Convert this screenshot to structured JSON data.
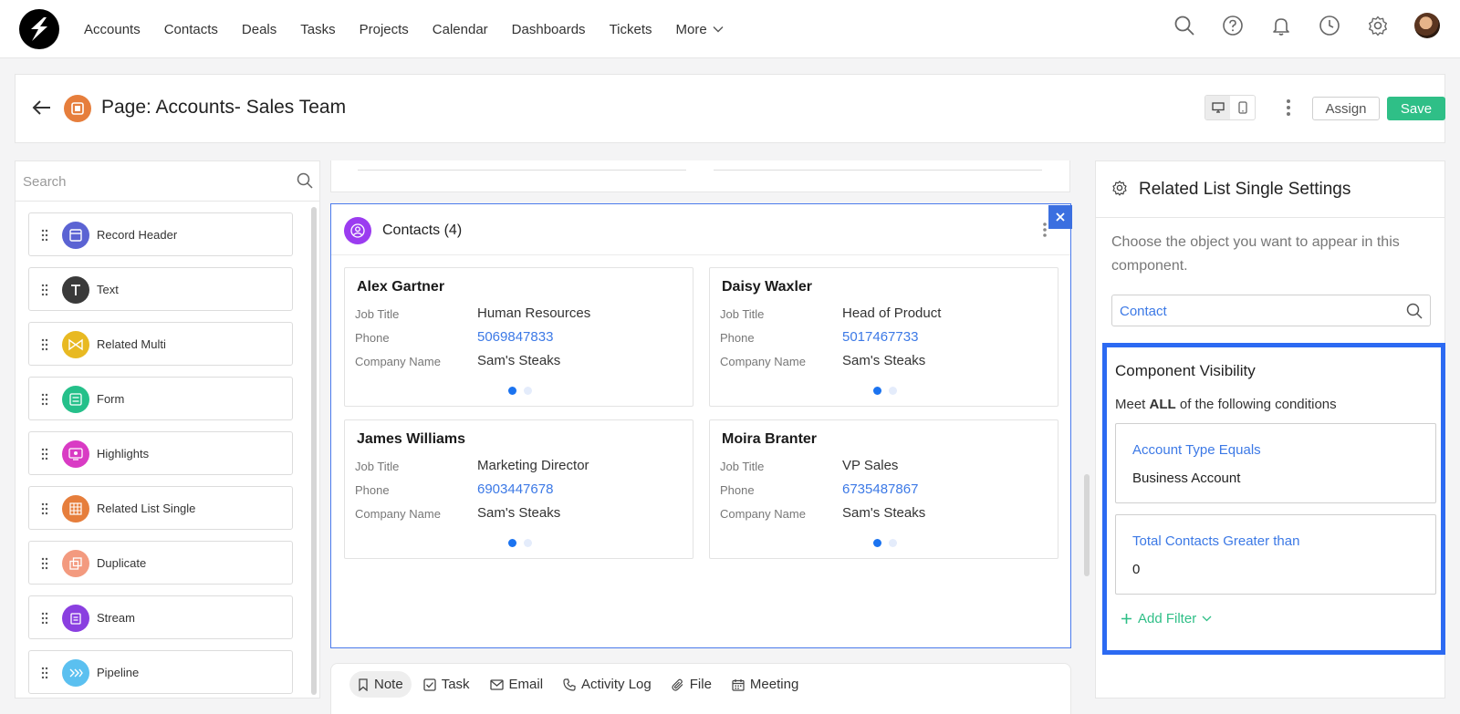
{
  "nav": {
    "items": [
      "Accounts",
      "Contacts",
      "Deals",
      "Tasks",
      "Projects",
      "Calendar",
      "Dashboards",
      "Tickets"
    ],
    "more_label": "More",
    "icons": [
      "search-icon",
      "help-icon",
      "bell-icon",
      "clock-icon",
      "gear-icon",
      "avatar"
    ]
  },
  "header": {
    "title": "Page: Accounts- Sales Team",
    "assign_label": "Assign",
    "save_label": "Save",
    "save_color": "#2fbf87"
  },
  "left_panel": {
    "search_placeholder": "Search",
    "components": [
      {
        "label": "Record Header",
        "icon": "record-header-icon",
        "color": "#5b63d3"
      },
      {
        "label": "Text",
        "icon": "text-icon",
        "color": "#3a3a3a"
      },
      {
        "label": "Related Multi",
        "icon": "related-multi-icon",
        "color": "#e8b922"
      },
      {
        "label": "Form",
        "icon": "form-icon",
        "color": "#25c08a"
      },
      {
        "label": "Highlights",
        "icon": "highlights-icon",
        "color": "#d93bc4"
      },
      {
        "label": "Related List Single",
        "icon": "related-list-single-icon",
        "color": "#e67e3c"
      },
      {
        "label": "Duplicate",
        "icon": "duplicate-icon",
        "color": "#f39a7f"
      },
      {
        "label": "Stream",
        "icon": "stream-icon",
        "color": "#8a3fe0"
      },
      {
        "label": "Pipeline",
        "icon": "pipeline-icon",
        "color": "#5bc0f0"
      }
    ]
  },
  "contacts": {
    "title": "Contacts (4)",
    "labels": {
      "job_title": "Job Title",
      "phone": "Phone",
      "company": "Company Name"
    },
    "cards": [
      {
        "name": "Alex Gartner",
        "job_title": "Human Resources",
        "phone": "5069847833",
        "company": "Sam's Steaks"
      },
      {
        "name": "Daisy Waxler",
        "job_title": "Head of Product",
        "phone": "5017467733",
        "company": "Sam's Steaks"
      },
      {
        "name": "James Williams",
        "job_title": "Marketing Director",
        "phone": "6903447678",
        "company": "Sam's Steaks"
      },
      {
        "name": "Moira Branter",
        "job_title": "VP Sales",
        "phone": "6735487867",
        "company": "Sam's Steaks"
      }
    ]
  },
  "tabs": [
    "Note",
    "Task",
    "Email",
    "Activity Log",
    "File",
    "Meeting"
  ],
  "right_panel": {
    "title": "Related List Single Settings",
    "description": "Choose the object you want to appear in this component.",
    "object_value": "Contact",
    "visibility": {
      "title": "Component Visibility",
      "meet_prefix": "Meet",
      "meet_bold": "ALL",
      "meet_suffix": "of the following conditions",
      "conditions": [
        {
          "field": "Account Type Equals",
          "value": "Business Account"
        },
        {
          "field": "Total Contacts Greater than",
          "value": "0"
        }
      ],
      "add_filter_label": "Add Filter",
      "highlight_color": "#2c6af2"
    }
  }
}
